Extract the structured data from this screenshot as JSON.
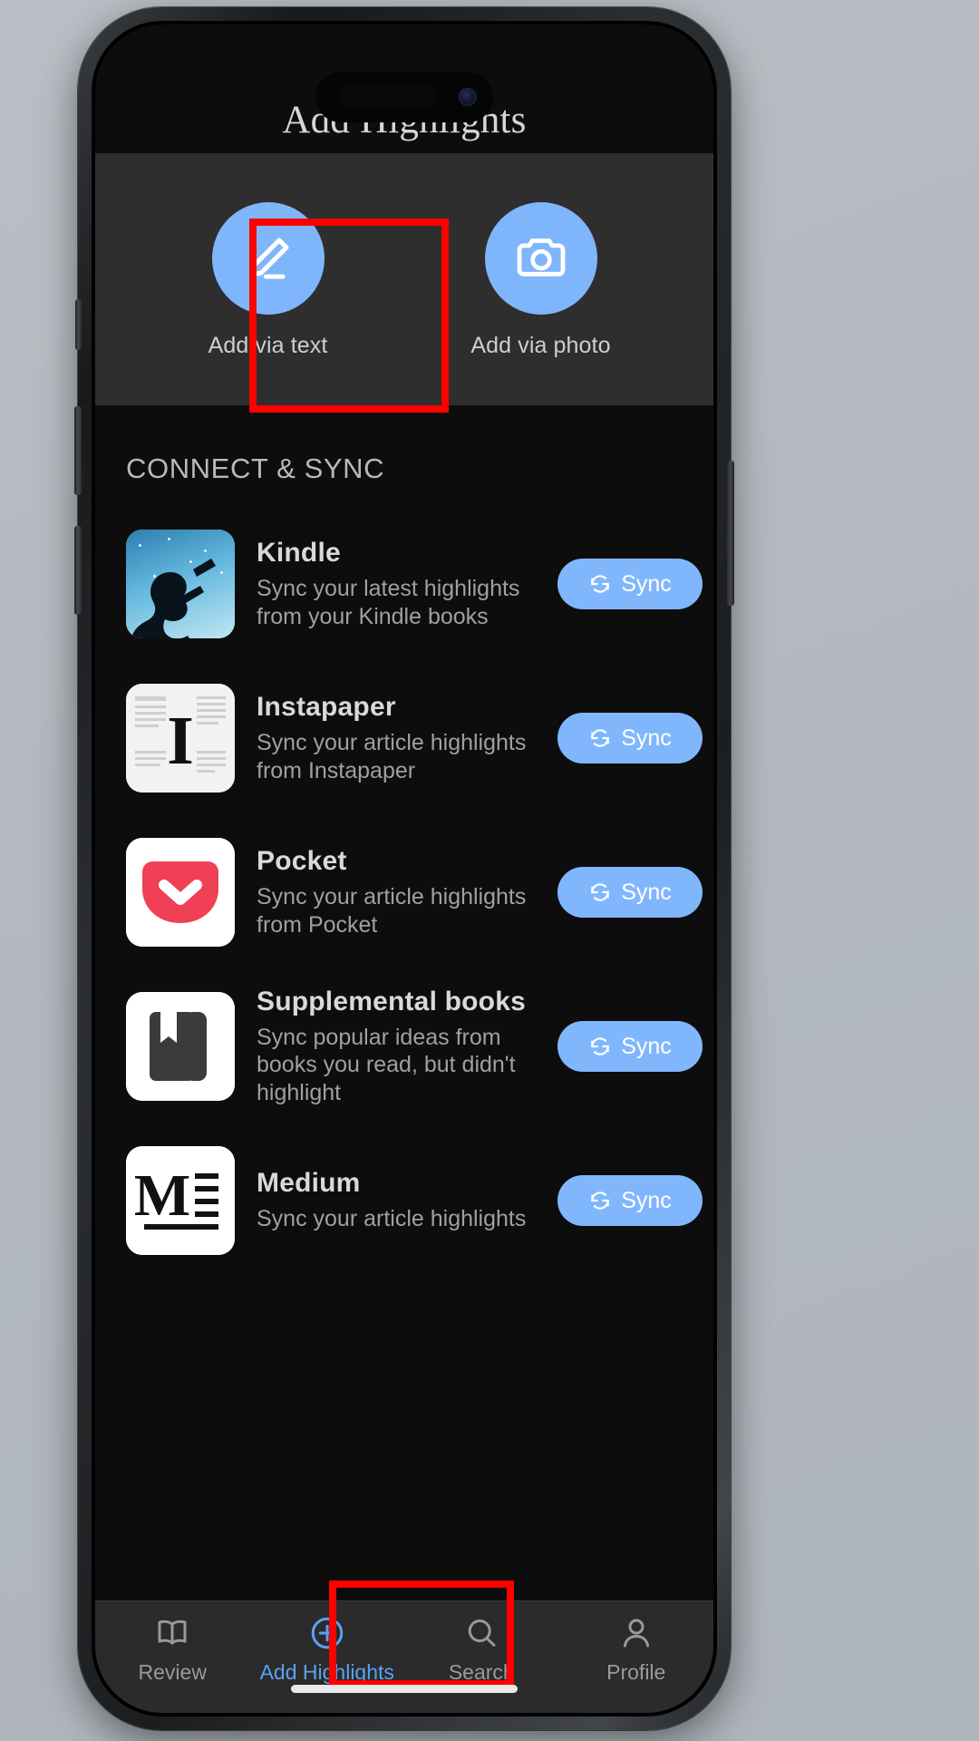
{
  "header": {
    "title": "Add Highlights"
  },
  "add_panel": {
    "options": [
      {
        "label": "Add via text",
        "icon": "pencil-icon",
        "highlighted": true
      },
      {
        "label": "Add via photo",
        "icon": "camera-icon",
        "highlighted": false
      }
    ],
    "circle_color": "#7fb6fb",
    "panel_color": "#2e2e2e"
  },
  "connect_sync": {
    "section_title": "CONNECT & SYNC",
    "sync_button_label": "Sync",
    "sync_button_color": "#80b7fc",
    "services": [
      {
        "name": "Kindle",
        "description": "Sync your latest highlights from your Kindle books",
        "icon": "kindle-icon",
        "action": "Sync"
      },
      {
        "name": "Instapaper",
        "description": "Sync your article highlights from Instapaper",
        "icon": "instapaper-icon",
        "action": "Sync"
      },
      {
        "name": "Pocket",
        "description": "Sync your article highlights from Pocket",
        "icon": "pocket-icon",
        "action": "Sync"
      },
      {
        "name": "Supplemental books",
        "description": "Sync popular ideas from books you read, but didn't highlight",
        "icon": "supplemental-books-icon",
        "action": "Sync"
      },
      {
        "name": "Medium",
        "description": "Sync your article highlights",
        "icon": "medium-icon",
        "action": "Sync"
      }
    ]
  },
  "tabbar": {
    "tabs": [
      {
        "label": "Review",
        "icon": "book-icon",
        "active": false
      },
      {
        "label": "Add Highlights",
        "icon": "plus-circle-icon",
        "active": true
      },
      {
        "label": "Search",
        "icon": "search-icon",
        "active": false
      },
      {
        "label": "Profile",
        "icon": "person-icon",
        "active": false
      }
    ],
    "active_color": "#5aa2f5",
    "inactive_color": "#9a9a9a"
  },
  "annotations": {
    "color": "#ff0000",
    "boxes": [
      {
        "target": "Add via text"
      },
      {
        "target": "Add Highlights tab"
      }
    ]
  }
}
